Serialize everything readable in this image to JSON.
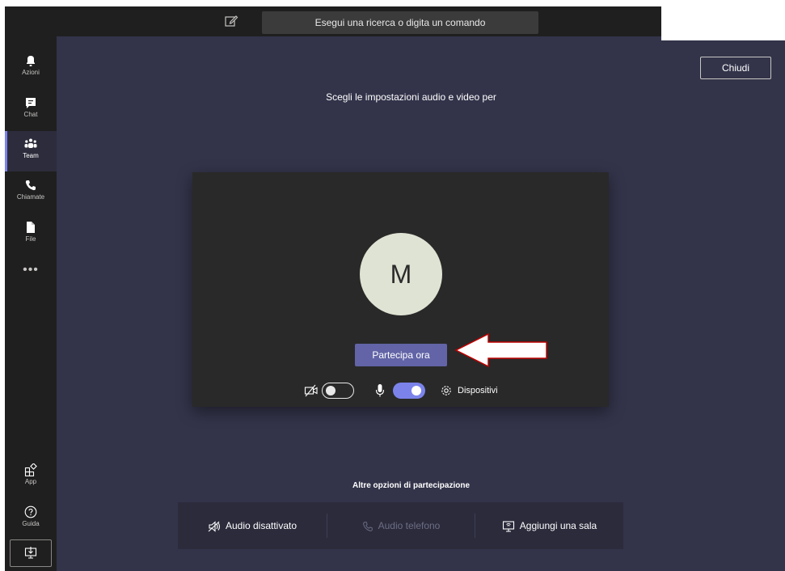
{
  "topbar": {
    "search_placeholder": "Esegui una ricerca o digita un comando"
  },
  "rail": {
    "items": [
      {
        "label": "Azioni",
        "icon": "bell-icon"
      },
      {
        "label": "Chat",
        "icon": "chat-icon"
      },
      {
        "label": "Team",
        "icon": "teams-icon",
        "active": true
      },
      {
        "label": "Chiamate",
        "icon": "phone-icon"
      },
      {
        "label": "File",
        "icon": "file-icon"
      }
    ],
    "more": "•••",
    "bottom": [
      {
        "label": "App",
        "icon": "apps-icon"
      },
      {
        "label": "Guida",
        "icon": "help-icon"
      }
    ]
  },
  "main": {
    "close_label": "Chiudi",
    "prompt": "Scegli le impostazioni audio e video per",
    "avatar_initial": "M",
    "join_label": "Partecipa ora",
    "camera_on": false,
    "mic_on": true,
    "devices_label": "Dispositivi"
  },
  "other_options": {
    "title": "Altre opzioni di partecipazione",
    "audio_off": "Audio disattivato",
    "phone_audio": "Audio telefono",
    "add_room": "Aggiungi una sala"
  },
  "colors": {
    "accent": "#6264a7",
    "toggle_on": "#7b83eb",
    "background": "#33344a",
    "rail": "#1f1f1f",
    "arrow_outline": "#c00000"
  }
}
